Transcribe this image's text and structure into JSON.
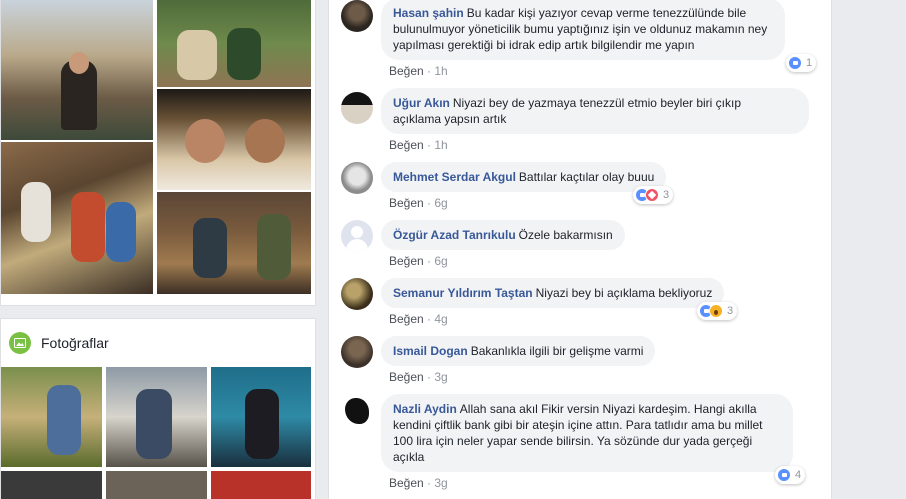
{
  "photos_card": {
    "title": "Fotoğraflar"
  },
  "comments": [
    {
      "name": "Hasan şahin",
      "lines": [
        "Bu kadar kişi yazıyor cevap verme tenezzülünde bile",
        "bulunulmuyor yöneticilik bumu yaptığınız işin ve oldunuz makamın ney",
        "yapılması gerektiği bi idrak edip artık bilgilendir me yapın"
      ],
      "like_label": "Beğen",
      "time": "1h",
      "reaction_count": "1",
      "reactions": [
        "like"
      ]
    },
    {
      "name": "Uğur Akın",
      "lines": [
        "Niyazi bey de yazmaya tenezzül etmio beyler biri çıkıp",
        "açıklama yapsın artık"
      ],
      "like_label": "Beğen",
      "time": "1h",
      "reaction_count": "",
      "reactions": []
    },
    {
      "name": "Mehmet Serdar Akgul",
      "lines": [
        "Battılar kaçtılar olay buuu"
      ],
      "like_label": "Beğen",
      "time": "6g",
      "reaction_count": "3",
      "reactions": [
        "like",
        "love"
      ]
    },
    {
      "name": "Özgür Azad Tanrıkulu",
      "lines": [
        "Özele bakarmısın"
      ],
      "like_label": "Beğen",
      "time": "6g",
      "reaction_count": "",
      "reactions": []
    },
    {
      "name": "Semanur Yıldırım Taştan",
      "lines": [
        "Niyazi bey bi açıklama bekliyoruz"
      ],
      "like_label": "Beğen",
      "time": "4g",
      "reaction_count": "3",
      "reactions": [
        "like",
        "wow"
      ]
    },
    {
      "name": "Ismail Dogan",
      "lines": [
        "Bakanlıkla ilgili bir gelişme varmi"
      ],
      "like_label": "Beğen",
      "time": "3g",
      "reaction_count": "",
      "reactions": []
    },
    {
      "name": "Nazli Aydin",
      "lines": [
        "Allah sana akıl Fikir versin Niyazi kardeşim. Hangi akılla",
        "kendini çiftlik bank gibi bir ateşin içine attın. Para tatlıdır ama bu millet",
        "100 lira için neler yapar sende bilirsin. Ya sözünde dur yada gerçeği",
        "açıkla"
      ],
      "like_label": "Beğen",
      "time": "3g",
      "reaction_count": "4",
      "reactions": [
        "like"
      ]
    }
  ],
  "colors": {
    "link": "#385898",
    "bubble": "#f2f3f5",
    "meta": "#90949c",
    "like": "#5890ff",
    "love": "#f25268",
    "wow": "#f7b125",
    "photos_icon": "#7ac143"
  }
}
